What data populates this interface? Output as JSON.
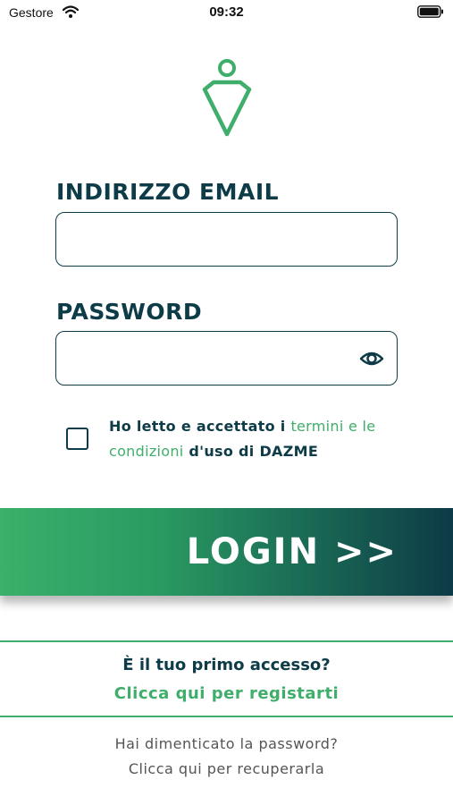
{
  "status_bar": {
    "carrier": "Gestore",
    "time": "09:32",
    "wifi_icon": "wifi-icon",
    "battery_icon": "battery-icon"
  },
  "logo": {
    "icon": "dazme-logo-icon",
    "color": "#3fae6b"
  },
  "email": {
    "label": "INDIRIZZO EMAIL",
    "value": "",
    "placeholder": ""
  },
  "password": {
    "label": "PASSWORD",
    "value": "",
    "placeholder": "",
    "toggle_icon": "eye-icon"
  },
  "terms": {
    "checked": false,
    "text_before": "Ho letto e accettato i ",
    "link_text": "termini e le condizioni",
    "text_after": " d'uso di DAZME"
  },
  "login_button": {
    "label": "LOGIN >>"
  },
  "register": {
    "question": "È il tuo primo accesso?",
    "link": "Clicca qui per registarti"
  },
  "recover": {
    "question": "Hai dimenticato la password?",
    "link": "Clicca qui per recuperarla"
  },
  "colors": {
    "primary_dark": "#0d3b47",
    "accent_green": "#3fae6b",
    "muted_text": "#555555"
  }
}
